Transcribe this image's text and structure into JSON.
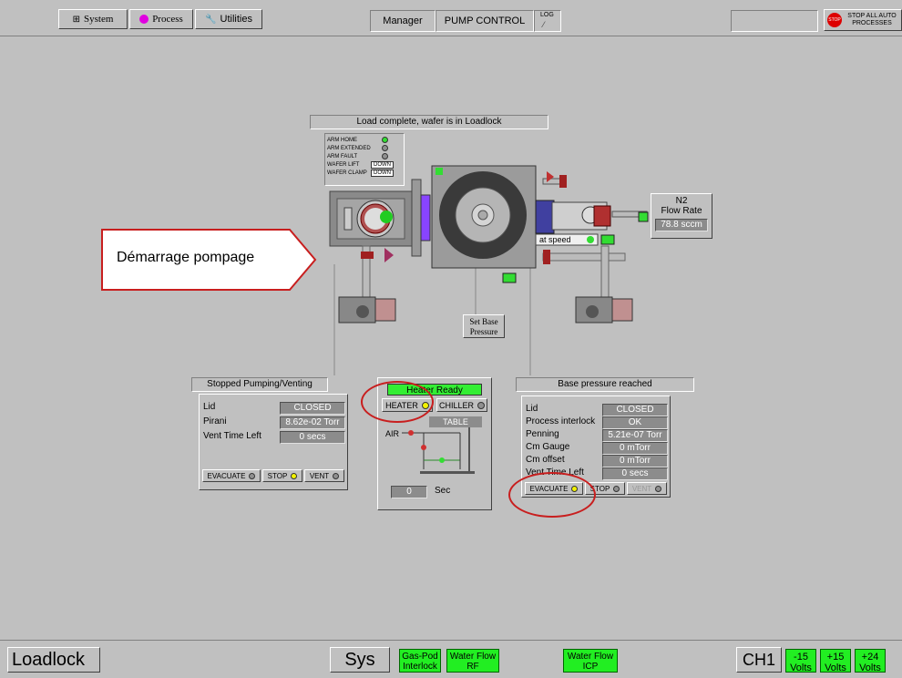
{
  "menu": {
    "system": "System",
    "process": "Process",
    "utilities": "Utilities"
  },
  "header": {
    "user": "Manager",
    "title": "PUMP CONTROL",
    "log": "LOG"
  },
  "stop_button": {
    "label": "STOP ALL AUTO PROCESSES",
    "badge": "STOP"
  },
  "status_message": "Load complete, wafer is in Loadlock",
  "arm_status": [
    {
      "label": "ARM HOME",
      "value": ""
    },
    {
      "label": "ARM EXTENDED",
      "value": ""
    },
    {
      "label": "ARM FAULT",
      "value": ""
    },
    {
      "label": "WAFER LIFT",
      "value": "DOWN"
    },
    {
      "label": "WAFER CLAMP",
      "value": "DOWN"
    }
  ],
  "n2": {
    "title_line1": "N2",
    "title_line2": "Flow Rate",
    "value": "78.8 sccm"
  },
  "at_speed": "at speed",
  "set_base_pressure": {
    "line1": "Set Base",
    "line2": "Pressure"
  },
  "annotation": "Démarrage pompage",
  "left_panel": {
    "title": "Stopped Pumping/Venting",
    "rows": [
      {
        "label": "Lid",
        "value": "CLOSED"
      },
      {
        "label": "Pirani",
        "value": "8.62e-02 Torr"
      },
      {
        "label": "Vent Time Left",
        "value": "0 secs"
      }
    ],
    "buttons": [
      "EVACUATE",
      "STOP",
      "VENT"
    ]
  },
  "heater_panel": {
    "status": "Heater Ready",
    "heater_btn": "HEATER",
    "chiller_btn": "CHILLER",
    "table_label": "TABLE",
    "air_label": "AIR",
    "sec_value": "0",
    "sec_label": "Sec"
  },
  "right_panel": {
    "title": "Base pressure reached",
    "rows": [
      {
        "label": "Lid",
        "value": "CLOSED"
      },
      {
        "label": "Process interlock",
        "value": "OK"
      },
      {
        "label": "Penning",
        "value": "5.21e-07 Torr"
      },
      {
        "label": "Cm Gauge",
        "value": "0 mTorr"
      },
      {
        "label": "Cm offset",
        "value": "0 mTorr"
      },
      {
        "label": "Vent Time Left",
        "value": "0 secs"
      }
    ],
    "buttons": [
      "EVACUATE",
      "STOP",
      "VENT"
    ]
  },
  "bottom": {
    "loadlock": "Loadlock",
    "sys": "Sys",
    "gas_pod": {
      "line1": "Gas-Pod",
      "line2": "Interlock"
    },
    "water_rf": {
      "line1": "Water Flow",
      "line2": "RF"
    },
    "water_icp": {
      "line1": "Water Flow",
      "line2": "ICP"
    },
    "ch1": "CH1",
    "volts": [
      {
        "line1": "-15",
        "line2": "Volts"
      },
      {
        "line1": "+15",
        "line2": "Volts"
      },
      {
        "line1": "+24",
        "line2": "Volts"
      }
    ]
  },
  "colors": {
    "background": "#c0c0c0",
    "indicator_green": "#33ee33",
    "indicator_yellow": "#f2f200",
    "annotation_red": "#c81e1e"
  }
}
